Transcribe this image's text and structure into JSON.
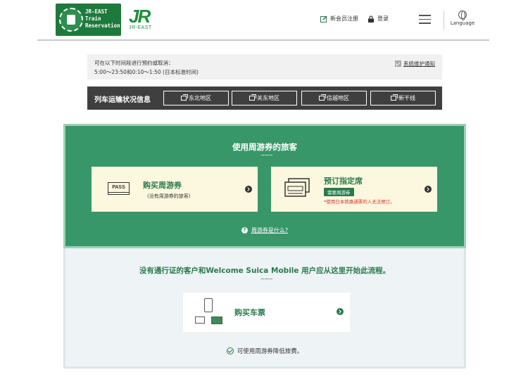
{
  "header": {
    "logo_text": "JR-EAST\nTrain\nReservation",
    "jr_mark": "JR",
    "jr_sub": "JR-EAST",
    "register_label": "新会员注册",
    "login_label": "登录",
    "language_label": "Language"
  },
  "notice": {
    "line1": "可在以下时间段进行预约或取消：",
    "line2": "5:00～23:50和0:10～1:50 (日本标准时间)",
    "maintenance_link": "系统维护通知"
  },
  "region_bar": {
    "title": "列车运输状况信息",
    "buttons": [
      "东北地区",
      "关东地区",
      "信越地区",
      "新干线"
    ]
  },
  "pass_section": {
    "title": "使用周游券的旅客",
    "wave": "~~~",
    "buy_pass": {
      "icon_text": "PASS",
      "title": "购买周游券",
      "subtitle": "(没有周游券的旅客)"
    },
    "reserve_seat": {
      "title": "预订指定席",
      "badge": "需要周游券",
      "note": "*使用日本铁路通票的人无法预订。"
    },
    "what_is_link": "周游券是什么?"
  },
  "ticket_section": {
    "title": "没有通行证的客户和Welcome Suica Mobile 用户应从这里开始此流程。",
    "wave": "~~~",
    "buy_ticket": "购买车票",
    "footer": "可使用周游券降低旅费。"
  },
  "colors": {
    "brand_green": "#1e7a3c",
    "panel_green": "#379768",
    "card_cream": "#fcf8df",
    "region_bar": "#3f3f3f",
    "note_red": "#d0342c"
  }
}
